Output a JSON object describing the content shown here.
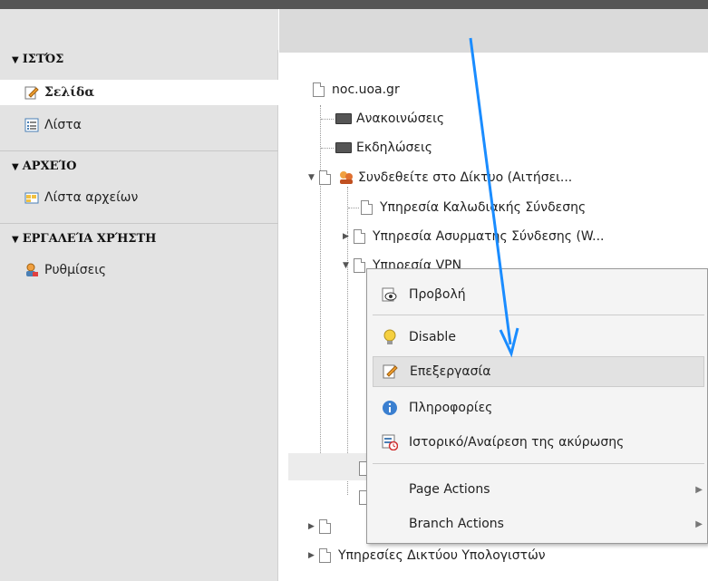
{
  "sidebar": {
    "sections": [
      {
        "title": "ΙΣΤΌΣ",
        "items": [
          {
            "label": "Σελίδα",
            "icon": "page-edit-icon"
          },
          {
            "label": "Λίστα",
            "icon": "list-icon"
          }
        ]
      },
      {
        "title": "ΑΡΧΕΊΟ",
        "items": [
          {
            "label": "Λίστα αρχείων",
            "icon": "file-list-icon"
          }
        ]
      },
      {
        "title": "ΕΡΓΑΛΕΊΑ ΧΡΉΣΤΗ",
        "items": [
          {
            "label": "Ρυθμίσεις",
            "icon": "user-settings-icon"
          }
        ]
      }
    ]
  },
  "tree": {
    "root": "noc.uoa.gr",
    "nodes": [
      "Ανακοινώσεις",
      "Εκδηλώσεις",
      "Συνδεθείτε στο Δίκτυο (Αιτήσει...",
      "Υπηρεσία Καλωδιακής Σύνδεσης",
      "Υπηρεσία Ασυρματης Σύνδεσης (W...",
      "Υπηρεσία VPN",
      "Υπηρεσίες Δικτύου Υπολογιστών"
    ]
  },
  "context_menu": {
    "items": [
      {
        "label": "Προβολή",
        "icon": "eye-icon"
      },
      {
        "label": "Disable",
        "icon": "lightbulb-icon"
      },
      {
        "label": "Επεξεργασία",
        "icon": "pencil-icon"
      },
      {
        "label": "Πληροφορίες",
        "icon": "info-icon"
      },
      {
        "label": "Ιστορικό/Αναίρεση της ακύρωσης",
        "icon": "history-icon"
      },
      {
        "label": "Page Actions",
        "icon": ""
      },
      {
        "label": "Branch Actions",
        "icon": ""
      }
    ]
  },
  "colors": {
    "arrow": "#1a8cff",
    "highlight": "#e2e2e2"
  }
}
